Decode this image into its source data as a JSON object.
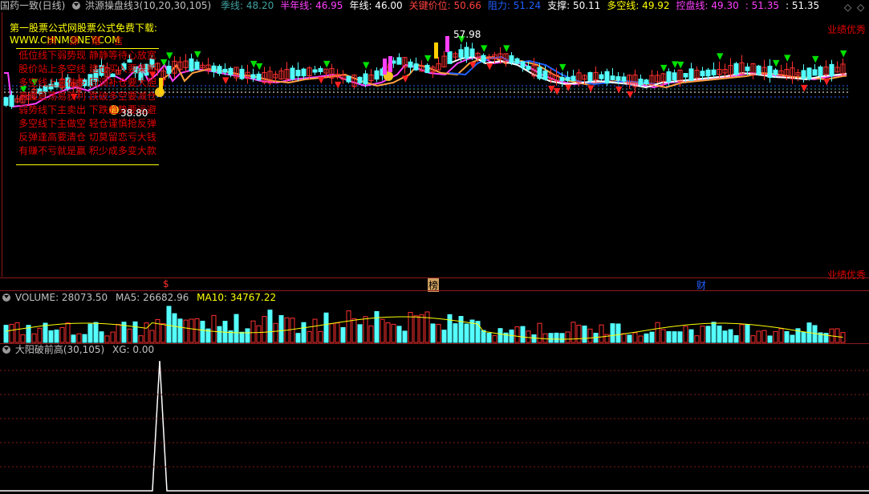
{
  "main_header": {
    "stock_name": "国药一致(日线)",
    "indicator": "洪源操盘线3(10,20,30,105)",
    "items": [
      {
        "label": "季线:",
        "value": "48.20",
        "color": "#40a0a0"
      },
      {
        "label": "半年线:",
        "value": "46.95",
        "color": "#ff40ff"
      },
      {
        "label": "年线:",
        "value": "46.00",
        "color": "#ffffff"
      },
      {
        "label": "关键价位:",
        "value": "50.66",
        "color": "#ff4040"
      },
      {
        "label": "阻力:",
        "value": "51.24",
        "color": "#2060ff"
      },
      {
        "label": "支撑:",
        "value": "50.11",
        "color": "#ffffff"
      },
      {
        "label": "多空线:",
        "value": "49.92",
        "color": "#ffff00"
      },
      {
        "label": "控盘线:",
        "value": "49.30",
        "color": "#ff40ff"
      },
      {
        "label": ":",
        "value": "51.35",
        "color": "#ff40ff"
      },
      {
        "label": ":",
        "value": "51.35",
        "color": "#ffffff"
      }
    ]
  },
  "info_box": {
    "title": "第一股票公式网股票公式免费下载: WWW.CHNMONEY.COM",
    "heading": "洪 源 赠 言",
    "lines": [
      "低位线下弱势现  静静等待心放宽",
      "股价站上多空线  建仓买入要果断",
      "多空线上主做多  回调补仓要大胆",
      "高位震荡易获利  跌破多空要减仓",
      "弱势线下主卖出  下跌趋势要远避",
      "多空线下主做空  轻仓谨慎抢反弹",
      "反弹逢高要清仓  切莫留恋亏大钱",
      "有赚不亏就是赢  积少成多变大款"
    ]
  },
  "main_chart": {
    "right_tag_top": "业绩优秀",
    "right_tag_bottom": "业绩优秀",
    "price_high_label": "57.98",
    "price_low_label": "38.80",
    "event_marks": [
      "$",
      "榜",
      "财"
    ]
  },
  "volume_header": {
    "title": "VOLUME: 28073.50",
    "ma5": "MA5: 26682.96",
    "ma10": "MA10: 34767.22"
  },
  "indicator_header": {
    "title": "大阳破前高(30,105)",
    "xg": "XG: 0.00"
  },
  "chart_data": {
    "type": "candlestick",
    "title": "国药一致(日线)",
    "price_range": [
      38.8,
      57.98
    ],
    "annotated_high": 57.98,
    "annotated_low": 38.8,
    "volume": {
      "last": 28073.5,
      "ma5": 26682.96,
      "ma10": 34767.22
    },
    "signal": {
      "name": "大阳破前高(30,105)",
      "xg": 0.0,
      "spikes": 1
    }
  },
  "colors": {
    "up": "#ff3030",
    "down": "#54ffff",
    "ma_white": "#ffffff",
    "ma_magenta": "#ff40ff",
    "ma_orange": "#ffa040",
    "ma_blue": "#2060ff",
    "separator": "#8b1a1a"
  },
  "icons": [
    "chevron-down-icon",
    "settings-gear-icon",
    "arrow-left-icon",
    "arrow-right-icon"
  ]
}
